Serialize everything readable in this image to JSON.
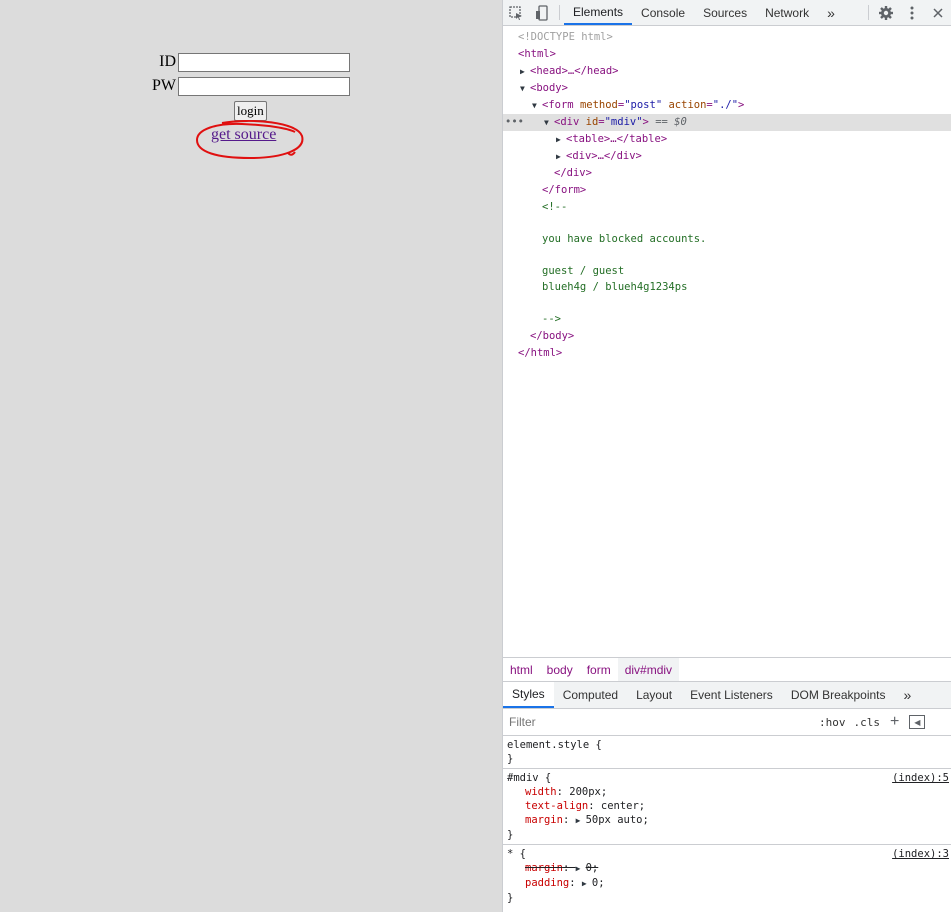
{
  "page": {
    "id_label": "ID",
    "pw_label": "PW",
    "id_value": "",
    "pw_value": "",
    "login_label": "login",
    "get_source_label": "get source"
  },
  "devtools": {
    "tabs": [
      "Elements",
      "Console",
      "Sources",
      "Network"
    ],
    "more_tabs": "»",
    "dom": {
      "doctype": "<!DOCTYPE html>",
      "html_open": "<html>",
      "head": "<head>…</head>",
      "body_open": "<body>",
      "form_tag": "form",
      "form_attr1_name": "method",
      "form_attr1_value": "\"post\"",
      "form_attr2_name": "action",
      "form_attr2_value": "\"./\"",
      "div_tag": "div",
      "div_attr_name": "id",
      "div_attr_value": "\"mdiv\"",
      "selected_marker": "== $0",
      "table": "<table>…</table>",
      "inner_div": "<div>…</div>",
      "div_close": "</div>",
      "form_close": "</form>",
      "comment_open": "<!--",
      "comment_line1": "you have blocked accounts.",
      "comment_line2": "guest / guest",
      "comment_line3": "blueh4g / blueh4g1234ps",
      "comment_close": "-->",
      "body_close": "</body>",
      "html_close": "</html>"
    },
    "breadcrumbs": [
      "html",
      "body",
      "form",
      "div#mdiv"
    ],
    "subtabs": [
      "Styles",
      "Computed",
      "Layout",
      "Event Listeners",
      "DOM Breakpoints"
    ],
    "filter_placeholder": "Filter",
    "hov": ":hov",
    "cls": ".cls",
    "plus": "+",
    "styles": {
      "element_style": "element.style {",
      "close_brace": "}",
      "mdiv_selector": "#mdiv {",
      "mdiv_source": "(index):5",
      "mdiv_decls": [
        {
          "name": "width",
          "value": "200px;"
        },
        {
          "name": "text-align",
          "value": "center;"
        },
        {
          "name": "margin",
          "value": "50px auto;"
        }
      ],
      "star_selector": "* {",
      "star_source": "(index):3",
      "star_decls": [
        {
          "name": "margin",
          "value": "0;"
        },
        {
          "name": "padding",
          "value": "0;"
        }
      ]
    }
  }
}
